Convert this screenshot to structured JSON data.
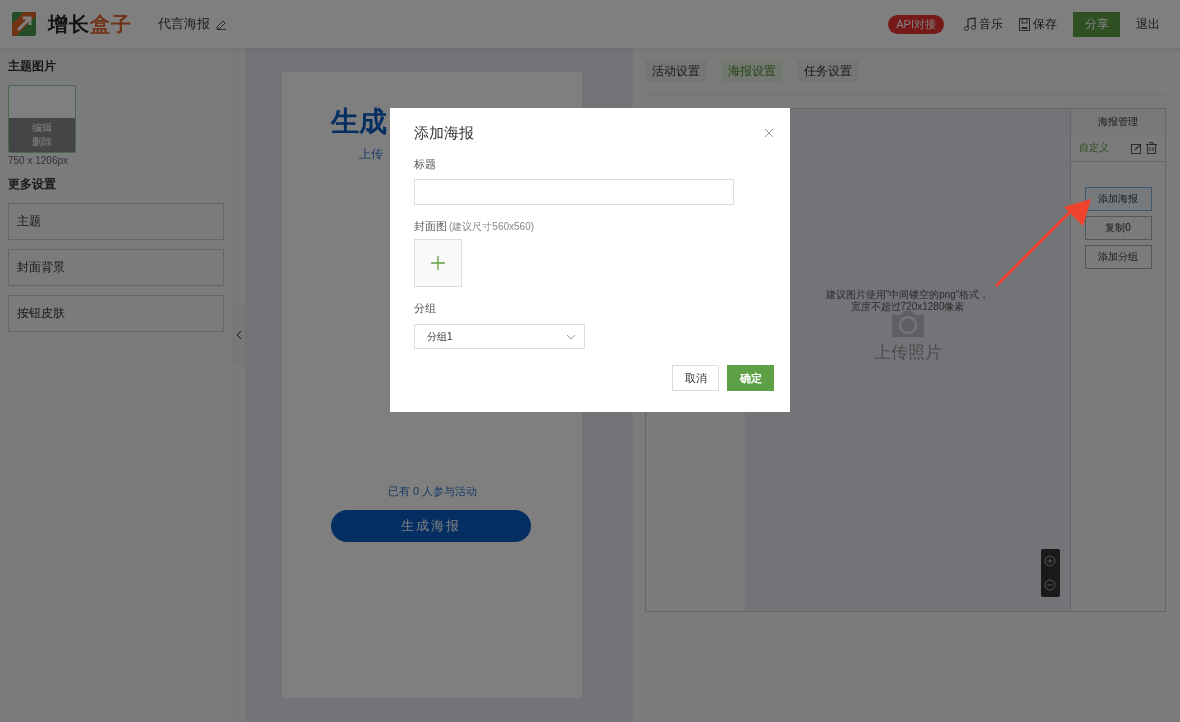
{
  "header": {
    "logo": {
      "text": "增长",
      "accent": "盒子"
    },
    "title": "代言海报",
    "badge": "API对接",
    "actions": [
      {
        "kind": "music",
        "label": "音乐"
      },
      {
        "kind": "save",
        "label": "保存"
      }
    ],
    "share": "分享",
    "logout": "退出"
  },
  "sidebar": {
    "theme_heading": "主题图片",
    "thumb_actions": [
      "编辑",
      "删除"
    ],
    "thumb_size": "750 x 1206px",
    "more_heading": "更多设置",
    "items": [
      "主题",
      "封面背景",
      "按钮皮肤"
    ]
  },
  "poster": {
    "title": "生成",
    "subtitle": "上传",
    "participants": "已有 0 人参与活动",
    "button": "生成海报"
  },
  "tabs": [
    {
      "label": "活动设置",
      "selected": false
    },
    {
      "label": "海报设置",
      "selected": true
    },
    {
      "label": "任务设置",
      "selected": false
    }
  ],
  "editor": {
    "hint_lines": [
      "建议图片使用\"中间镂空的png\"格式，",
      "宽度不超过720x1280像素"
    ],
    "upload": "上传照片"
  },
  "manager": {
    "heading": "海报管理",
    "items": [
      {
        "label": "自定义",
        "selected": true
      }
    ],
    "buttons": [
      {
        "label": "添加海报",
        "highlighted": true
      },
      {
        "label": "复制0",
        "highlighted": false
      },
      {
        "label": "添加分组",
        "highlighted": false
      }
    ]
  },
  "modal": {
    "title": "添加海报",
    "fields": [
      {
        "kind": "text",
        "label": "标题"
      },
      {
        "kind": "upload",
        "label": "封面图",
        "note": "(建议尺寸560x560)"
      },
      {
        "kind": "select",
        "label": "分组",
        "value": "分组1"
      }
    ],
    "buttons": [
      {
        "kind": "cancel",
        "label": "取消"
      },
      {
        "kind": "confirm",
        "label": "确定"
      }
    ]
  }
}
